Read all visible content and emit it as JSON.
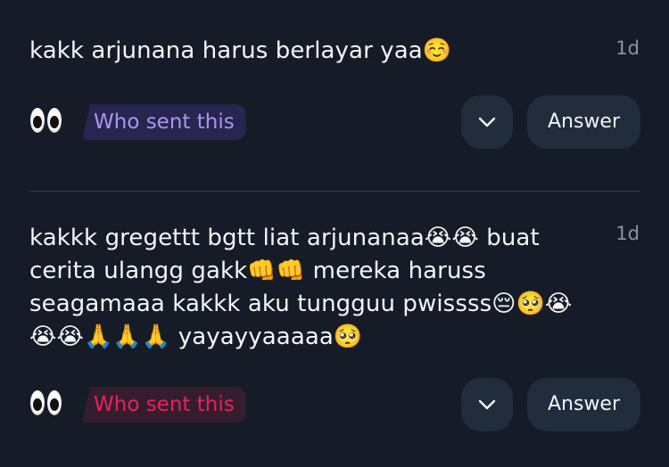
{
  "messages": [
    {
      "text": "kakk arjunana harus berlayar yaa☺️",
      "time": "1d",
      "reaction_icon": "eyes-icon",
      "who_sent_label": "Who sent this",
      "who_sent_color": "#a699ec",
      "answer_label": "Answer"
    },
    {
      "text": "kakkk gregettt bgtt liat arjunanaa😭😭 buat cerita ulangg gakk👊👊 mereka haruss seagamaaa kakkk aku tungguu pwissss😔🥺😭😭😭🙏🙏🙏 yayayyaaaaa🥺",
      "time": "1d",
      "reaction_icon": "eyes-icon",
      "who_sent_label": "Who sent this",
      "who_sent_color": "#e3245b",
      "answer_label": "Answer"
    }
  ]
}
